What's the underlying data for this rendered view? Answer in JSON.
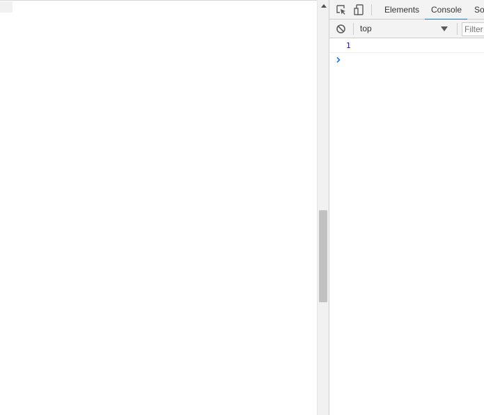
{
  "devtools": {
    "tabs": [
      {
        "label": "Elements",
        "active": false
      },
      {
        "label": "Console",
        "active": true
      },
      {
        "label": "So",
        "active": false
      }
    ],
    "toolbar": {
      "context": "top",
      "filter_placeholder": "Filter"
    },
    "console": {
      "messages": [
        "1"
      ]
    },
    "icons": {
      "inspect": "inspect-element-icon",
      "device": "device-toolbar-icon",
      "clear": "clear-console-icon",
      "prompt": "prompt-chevron-icon"
    },
    "colors": {
      "accent": "#1a73e8",
      "number": "#1c00cf",
      "prompt": "#1a73e8"
    }
  }
}
